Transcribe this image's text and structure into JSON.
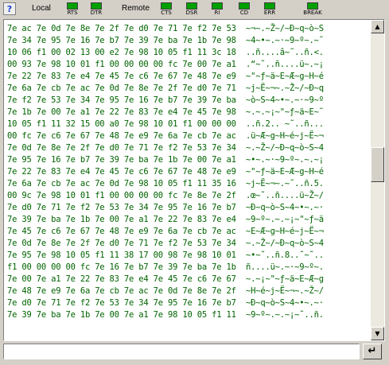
{
  "toolbar": {
    "help_glyph": "?",
    "local_label": "Local",
    "remote_label": "Remote",
    "local_signals": [
      {
        "label": "RTS",
        "state": "on"
      },
      {
        "label": "DTR",
        "state": "on"
      }
    ],
    "remote_signals": [
      {
        "label": "CTS",
        "state": "on"
      },
      {
        "label": "DSR",
        "state": "on"
      },
      {
        "label": "RI",
        "state": "on"
      },
      {
        "label": "CD",
        "state": "on"
      },
      {
        "label": "ERR",
        "state": "on"
      },
      {
        "label": "BREAK",
        "state": "on"
      }
    ],
    "led_on_color": "#00a000"
  },
  "terminal": {
    "text_color": "#006400",
    "lines": [
      "7e ac 7e 0d 7e 8e 7e 2f 7e d0 7e 71 7e f2 7e 53  ~¬~.~Ž~/~Ð~q~ò~S",
      "7e 34 7e 95 7e 16 7e b7 7e 39 7e ba 7e 1b 7e 98  ~4~•~.~·~9~º~.~˜",
      "10 06 f1 00 02 13 00 e2 7e 98 10 05 f1 11 3c 18  ..ñ....â~˜..ñ.<.",
      "00 93 7e 98 10 01 f1 00 00 00 00 fc 7e 00 7e a1  .“~˜..ñ....ü~.~¡",
      "7e 22 7e 83 7e e4 7e 45 7e c6 7e 67 7e 48 7e e9  ~\"~ƒ~ä~E~Æ~g~H~é",
      "7e 6a 7e cb 7e ac 7e 0d 7e 8e 7e 2f 7e d0 7e 71  ~j~Ë~¬~.~Ž~/~Ð~q",
      "7e f2 7e 53 7e 34 7e 95 7e 16 7e b7 7e 39 7e ba  ~ò~S~4~•~.~·~9~º",
      "7e 1b 7e 00 7e a1 7e 22 7e 83 7e e4 7e 45 7e 98  ~.~.~¡~\"~ƒ~ä~E~˜",
      "10 05 f1 11 32 15 00 a0 7e 98 10 01 f1 00 00 00  ..ñ.2.. ~˜..ñ...",
      "00 fc 7e c6 7e 67 7e 48 7e e9 7e 6a 7e cb 7e ac  .ü~Æ~g~H~é~j~Ë~¬",
      "7e 0d 7e 8e 7e 2f 7e d0 7e 71 7e f2 7e 53 7e 34  ~.~Ž~/~Ð~q~ò~S~4",
      "7e 95 7e 16 7e b7 7e 39 7e ba 7e 1b 7e 00 7e a1  ~•~.~·~9~º~.~.~¡",
      "7e 22 7e 83 7e e4 7e 45 7e c6 7e 67 7e 48 7e e9  ~\"~ƒ~ä~E~Æ~g~H~é",
      "7e 6a 7e cb 7e ac 7e 0d 7e 98 10 05 f1 11 35 16  ~j~Ë~¬~.~˜..ñ.5.",
      "00 9c 7e 98 10 01 f1 00 00 00 00 fc 7e 8e 7e 2f  .œ~˜..ñ....ü~Ž~/",
      "7e d0 7e 71 7e f2 7e 53 7e 34 7e 95 7e 16 7e b7  ~Ð~q~ò~S~4~•~.~·",
      "7e 39 7e ba 7e 1b 7e 00 7e a1 7e 22 7e 83 7e e4  ~9~º~.~.~¡~\"~ƒ~ä",
      "7e 45 7e c6 7e 67 7e 48 7e e9 7e 6a 7e cb 7e ac  ~E~Æ~g~H~é~j~Ë~¬",
      "7e 0d 7e 8e 7e 2f 7e d0 7e 71 7e f2 7e 53 7e 34  ~.~Ž~/~Ð~q~ò~S~4",
      "7e 95 7e 98 10 05 f1 11 38 17 00 98 7e 98 10 01  ~•~˜..ñ.8..˜~˜..",
      "f1 00 00 00 00 fc 7e 16 7e b7 7e 39 7e ba 7e 1b  ñ....ü~.~·~9~º~.",
      "7e 00 7e a1 7e 22 7e 83 7e e4 7e 45 7e c6 7e 67  ~.~¡~\"~ƒ~ä~E~Æ~g",
      "7e 48 7e e9 7e 6a 7e cb 7e ac 7e 0d 7e 8e 7e 2f  ~H~é~j~Ë~¬~.~Ž~/",
      "7e d0 7e 71 7e f2 7e 53 7e 34 7e 95 7e 16 7e b7  ~Ð~q~ò~S~4~•~.~·",
      "7e 39 7e ba 7e 1b 7e 00 7e a1 7e 98 10 05 f1 11  ~9~º~.~.~¡~˜..ñ."
    ]
  },
  "input": {
    "value": "",
    "enter_glyph": "↵"
  },
  "scrollbar": {
    "up_glyph": "▲",
    "down_glyph": "▼"
  }
}
